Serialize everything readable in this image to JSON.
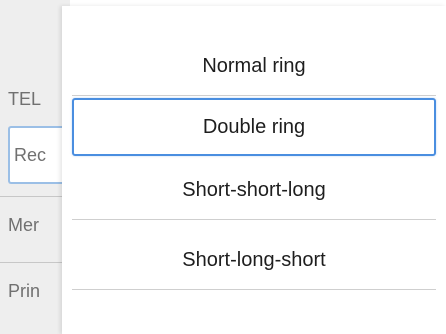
{
  "background_menu": {
    "items": [
      {
        "label": "TEL"
      },
      {
        "label": "Rec"
      },
      {
        "label": "Mer"
      },
      {
        "label": "Prin"
      }
    ]
  },
  "ring_options": {
    "items": [
      {
        "label": "Normal ring"
      },
      {
        "label": "Double ring"
      },
      {
        "label": "Short-short-long"
      },
      {
        "label": "Short-long-short"
      }
    ],
    "selected_label": "Double ring"
  },
  "colors": {
    "selection_border": "#4a8ee0",
    "separator": "#cfcfcf",
    "background_panel": "#eeeeee"
  }
}
